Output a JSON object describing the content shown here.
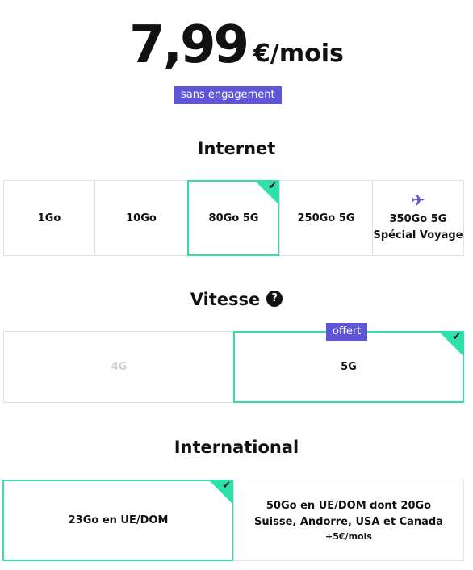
{
  "price": {
    "amount": "7,99",
    "unit": "€/mois",
    "badge": "sans engagement"
  },
  "internet": {
    "title": "Internet",
    "options": [
      {
        "label": "1Go",
        "selected": false
      },
      {
        "label": "10Go",
        "selected": false
      },
      {
        "label": "80Go 5G",
        "selected": true
      },
      {
        "label": "250Go 5G",
        "selected": false
      },
      {
        "label": "350Go 5G",
        "sublabel": "Spécial Voyage",
        "icon": "airplane-icon",
        "selected": false
      }
    ]
  },
  "vitesse": {
    "title": "Vitesse",
    "help_icon": "?",
    "options": [
      {
        "label": "4G",
        "selected": false,
        "disabled": true
      },
      {
        "label": "5G",
        "selected": true,
        "badge": "offert"
      }
    ]
  },
  "international": {
    "title": "International",
    "options": [
      {
        "label": "23Go en UE/DOM",
        "selected": true
      },
      {
        "line1": "50Go en UE/DOM dont 20Go",
        "line2": "Suisse, Andorre, USA et Canada",
        "price": "+5€/mois",
        "selected": false
      }
    ]
  },
  "colors": {
    "accent_green": "#2ee0a9",
    "badge_purple": "#5f55d9",
    "check_mark": "✔"
  }
}
